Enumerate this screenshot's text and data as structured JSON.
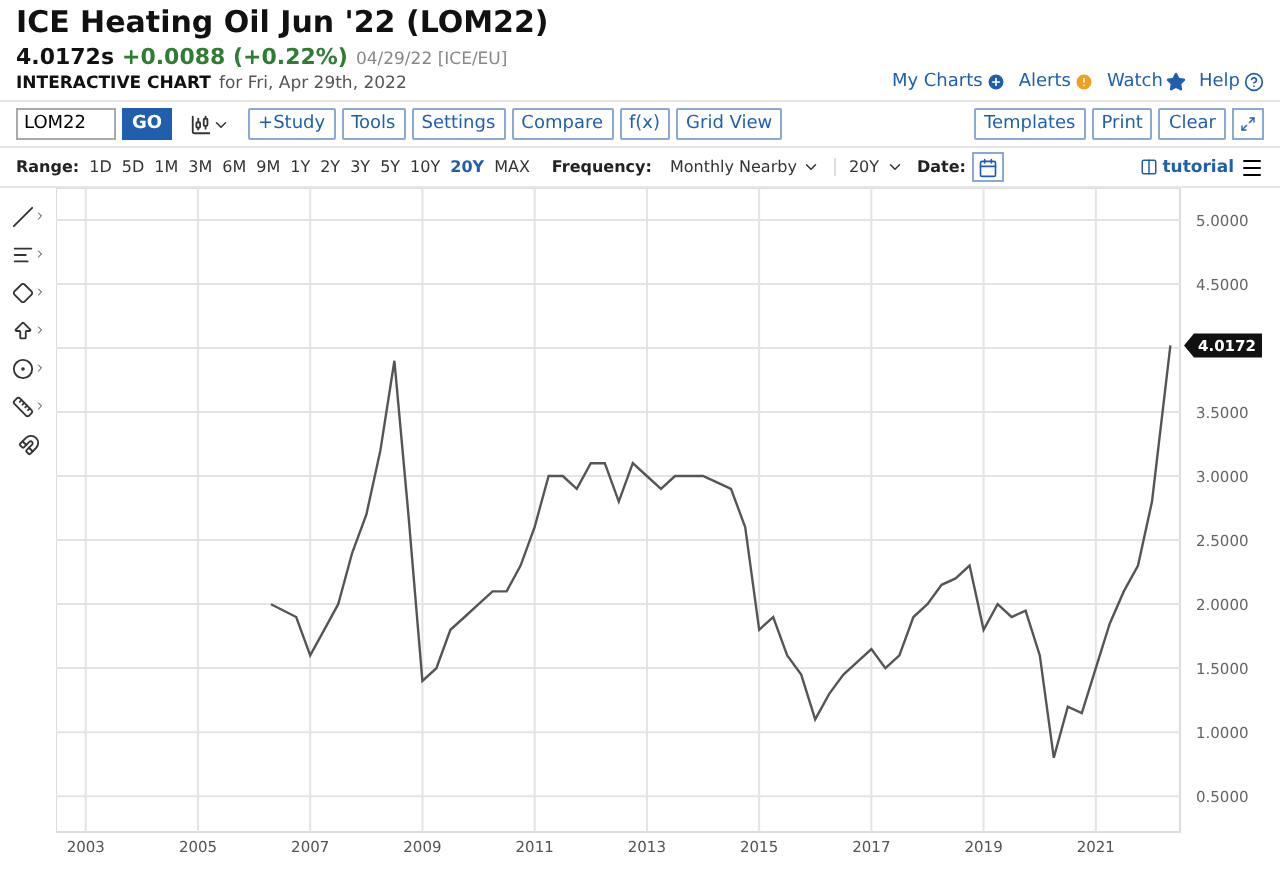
{
  "header": {
    "title": "ICE Heating Oil Jun '22 (LOM22)",
    "price": "4.0172s",
    "change": "+0.0088 (+0.22%)",
    "meta": "04/29/22 [ICE/EU]",
    "subtitle_label": "INTERACTIVE CHART",
    "subtitle": "for Fri, Apr 29th, 2022"
  },
  "top_links": [
    {
      "label": "My Charts",
      "kind": "plus"
    },
    {
      "label": "Alerts",
      "kind": "alert"
    },
    {
      "label": "Watch",
      "kind": "star"
    },
    {
      "label": "Help",
      "kind": "help"
    }
  ],
  "symbol_field": {
    "value": "LOM22"
  },
  "go_button": "GO",
  "toolbar_left": [
    "+Study",
    "Tools",
    "Settings",
    "Compare",
    "f(x)",
    "Grid View"
  ],
  "toolbar_right": [
    "Templates",
    "Print",
    "Clear"
  ],
  "range": {
    "label": "Range:",
    "options": [
      {
        "label": "1D",
        "selected": false
      },
      {
        "label": "5D",
        "selected": false
      },
      {
        "label": "1M",
        "selected": false
      },
      {
        "label": "3M",
        "selected": false
      },
      {
        "label": "6M",
        "selected": false
      },
      {
        "label": "9M",
        "selected": false
      },
      {
        "label": "1Y",
        "selected": false
      },
      {
        "label": "2Y",
        "selected": false
      },
      {
        "label": "3Y",
        "selected": false
      },
      {
        "label": "5Y",
        "selected": false
      },
      {
        "label": "10Y",
        "selected": false
      },
      {
        "label": "20Y",
        "selected": true
      },
      {
        "label": "MAX",
        "selected": false
      }
    ]
  },
  "frequency": {
    "label": "Frequency:",
    "value": "Monthly Nearby"
  },
  "period": {
    "value": "20Y"
  },
  "date": {
    "label": "Date:"
  },
  "tutorial": "tutorial",
  "chart": {
    "price_tag": "4.0172",
    "chart_data": {
      "type": "line",
      "xlim": [
        2002.47,
        2022.5
      ],
      "ylim": [
        0.22,
        5.25
      ],
      "grid": true,
      "xticks": [
        2003,
        2005,
        2007,
        2009,
        2011,
        2013,
        2015,
        2017,
        2019,
        2021
      ],
      "yticks": [
        {
          "value": 0.5,
          "label": "0.5000"
        },
        {
          "value": 1,
          "label": "1.0000"
        },
        {
          "value": 1.5,
          "label": "1.5000"
        },
        {
          "value": 2,
          "label": "2.0000"
        },
        {
          "value": 2.5,
          "label": "2.5000"
        },
        {
          "value": 3,
          "label": "3.0000"
        },
        {
          "value": 3.5,
          "label": "3.5000"
        },
        {
          "value": 4.5,
          "label": "4.5000"
        },
        {
          "value": 5,
          "label": "5.0000"
        }
      ],
      "x": [
        2006.3,
        2006.75,
        2007,
        2007.25,
        2007.5,
        2007.75,
        2008,
        2008.25,
        2008.5,
        2008.75,
        2009,
        2009.25,
        2009.5,
        2009.75,
        2010,
        2010.25,
        2010.5,
        2010.75,
        2011,
        2011.25,
        2011.5,
        2011.75,
        2012,
        2012.25,
        2012.5,
        2012.75,
        2013,
        2013.25,
        2013.5,
        2013.75,
        2014,
        2014.25,
        2014.5,
        2014.75,
        2015,
        2015.25,
        2015.5,
        2015.75,
        2016,
        2016.25,
        2016.5,
        2016.75,
        2017,
        2017.25,
        2017.5,
        2017.75,
        2018,
        2018.25,
        2018.5,
        2018.75,
        2019,
        2019.25,
        2019.5,
        2019.75,
        2020,
        2020.25,
        2020.5,
        2020.75,
        2021,
        2021.25,
        2021.5,
        2021.75,
        2022,
        2022.33
      ],
      "series": [
        {
          "color": "#555555",
          "values": [
            2.0,
            1.9,
            1.6,
            1.8,
            2.0,
            2.4,
            2.7,
            3.2,
            3.9,
            2.7,
            1.4,
            1.5,
            1.8,
            1.9,
            2.0,
            2.1,
            2.1,
            2.3,
            2.6,
            3.0,
            3.0,
            2.9,
            3.1,
            3.1,
            2.8,
            3.1,
            3.0,
            2.9,
            3.0,
            3.0,
            3.0,
            2.95,
            2.9,
            2.6,
            1.8,
            1.9,
            1.6,
            1.45,
            1.1,
            1.3,
            1.45,
            1.55,
            1.65,
            1.5,
            1.6,
            1.9,
            2.0,
            2.15,
            2.2,
            2.3,
            1.8,
            2.0,
            1.9,
            1.95,
            1.6,
            0.8,
            1.2,
            1.15,
            1.5,
            1.85,
            2.1,
            2.3,
            2.8,
            4.02
          ]
        }
      ]
    }
  }
}
